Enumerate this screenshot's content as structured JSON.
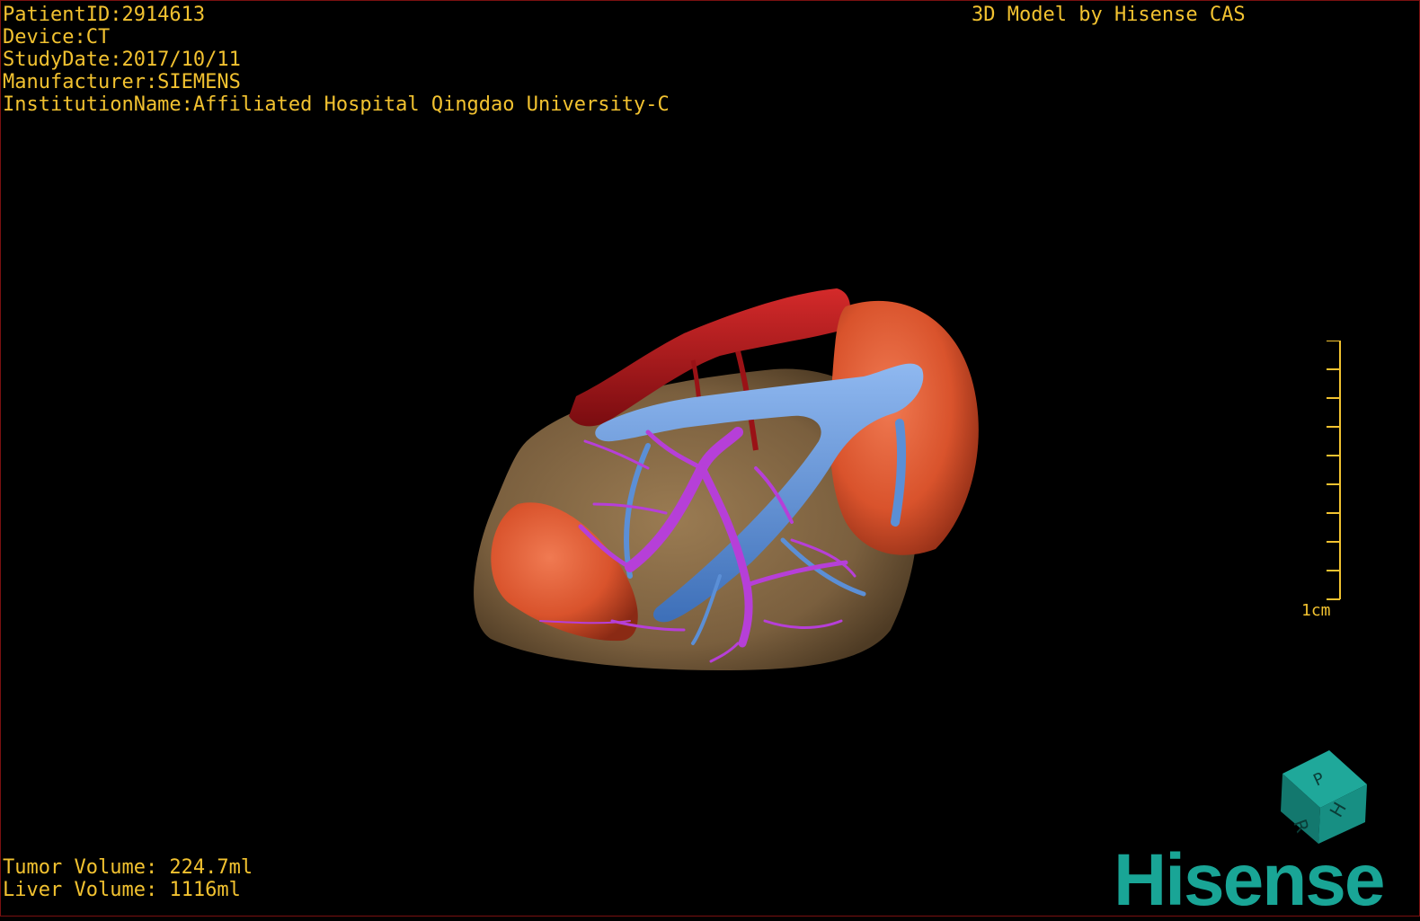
{
  "info": {
    "patient_id": "PatientID:2914613",
    "device": "Device:CT",
    "study_date": "StudyDate:2017/10/11",
    "manufacturer": "Manufacturer:SIEMENS",
    "institution": "InstitutionName:Affiliated Hospital Qingdao University-C"
  },
  "watermark": {
    "model_by": "3D Model by Hisense CAS"
  },
  "scale_bar": {
    "label": "1cm"
  },
  "volumes": {
    "tumor": "Tumor Volume: 224.7ml",
    "liver": "Liver Volume: 1116ml"
  },
  "orientation_cube": {
    "face_right": "H",
    "face_top": "P",
    "face_left": "R"
  },
  "logo": {
    "text": "Hisense"
  },
  "colors": {
    "overlay_text": "#f2c230",
    "liver": "#7a5f3e",
    "tumor": "#d9532c",
    "artery": "#b0151a",
    "portal_vein": "#5b8fd6",
    "hepatic_vein": "#b63fd8",
    "brand": "#19a596"
  }
}
